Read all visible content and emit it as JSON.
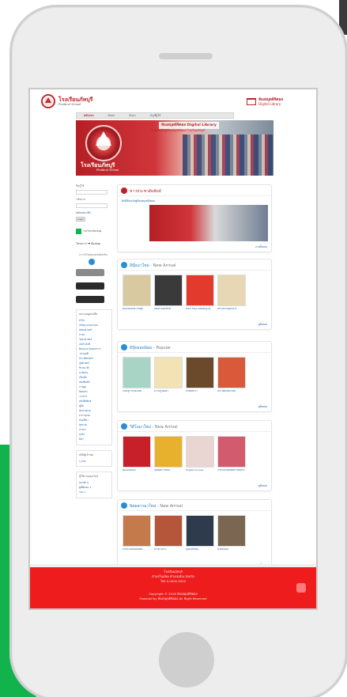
{
  "header": {
    "school_name_th": "โรงเรียนภัทบุรี",
    "school_name_en": "Phatburi School",
    "library_title": "ห้องสมุดดิจิตอล",
    "library_sub": "Digital Library"
  },
  "nav": {
    "items": [
      "หน้าแรก",
      "ติดต่อ",
      "ค้นหา",
      "บัญชีผู้ใช้"
    ]
  },
  "banner": {
    "library_name": "ห้องสมุดดิจิตอล Digital Library",
    "tagline": "ยินดีต้อนรับสู่ห้องสมุดดิจิตอล โรงเรียนภัทบุรี",
    "title_th": "โรงเรียนภัทบุรี",
    "title_en": "Phatburi School"
  },
  "sidebar": {
    "login_label": "ชื่อผู้ใช้",
    "password_label": "รหัสผ่าน",
    "register_link": "สมัครสมาชิก",
    "login_button": "Login",
    "promo1": "ร่วมรักษาห้องสมุด",
    "promo2": "โครงการ I ❤ ห้องสมุด",
    "app_text": "ดาวน์โหลดแอปพลิเคชัน",
    "categories_title": "หมวดหมู่หนังสือ",
    "categories": [
      "ทั่วไป",
      "ปรัชญาและศาสนา",
      "สังคมศาสตร์",
      "ภาษา",
      "วิทยาศาสตร์",
      "เทคโนโลยี",
      "ศิลปะและนันทนาการ",
      "วรรณคดี",
      "ประวัติศาสตร์",
      "ภูมิศาสตร์",
      "ชีวประวัติ",
      "นวนิยาย",
      "เรื่องสั้น",
      "หนังสือเด็ก",
      "การ์ตูน",
      "นิตยสาร",
      "วารสาร",
      "หนังสือพิมพ์",
      "คู่มือ",
      "พจนานุกรม",
      "สารานุกรม",
      "ท่องเที่ยว",
      "สุขภาพ",
      "อาหาร",
      "ธุรกิจ",
      "อื่นๆ"
    ],
    "stats_title": "สถิติผู้เข้าชม",
    "stats_value": "1,234",
    "online_title": "ผู้ใช้งานออนไลน์",
    "online_lines": [
      "สมาชิก 0",
      "ผู้เยี่ยมชม 1",
      "รวม 1"
    ]
  },
  "main": {
    "news": {
      "title": "ข่าวประชาสัมพันธ์",
      "link": "ยินดีต้อนรับสู่ห้องสมุดดิจิตอล",
      "more": "อ่านทั้งหมด"
    },
    "sections": [
      {
        "title_th": "อีบุ๊คมาใหม่",
        "title_en": "New Arrival",
        "color": "#2a8dd4",
        "books": [
          "ดอกไม้แห่งความสุข",
          "เส้นทางแห่งชีวิต",
          "Mind Map ฉบับสมบูรณ์",
          "สร้างแรงบันดาลใจ"
        ]
      },
      {
        "title_th": "อีบุ๊คยอดนิยม",
        "title_en": "Popular",
        "color": "#2a8dd4",
        "books": [
          "เรียนรู้ภาษาอังกฤษ",
          "ความรู้รอบตัว",
          "ชีวิตที่ดีกว่า",
          "ประวัติศาสตร์ไทย"
        ]
      },
      {
        "title_th": "วีดีโอมาใหม่",
        "title_en": "New Arrival",
        "color": "#2a8dd4",
        "books": [
          "พัฒนาตนเอง",
          "เทคนิคการสอน",
          "English Course",
          "ภาษาอังกฤษเพื่อการสื่อสาร"
        ]
      },
      {
        "title_th": "นิตยสารมาใหม่",
        "title_en": "New Arrival",
        "color": "#2a8dd4",
        "books": [
          "อาหารไทยยอดนิยม",
          "ครัวบ้านเรา",
          "บุคคลสำคัญ",
          "ชีวิตชนบท"
        ]
      }
    ],
    "more_label": "ดูทั้งหมด"
  },
  "footer": {
    "line1": "โรงเรียนภัทบุรี",
    "line2": "ตำบลในเมือง อำเภอเมือง จังหวัด",
    "line3": "โทร 0-0000-0000",
    "line4": "Copyright © 2016 ห้องสมุดดิจิตอล",
    "line5": "Powered by ห้องสมุดดิจิตอล All Right Reserved"
  },
  "colors": {
    "brand_red": "#b8252a",
    "footer_red": "#ee1c1c",
    "link_blue": "#1a5fa6",
    "accent_green": "#12b24d"
  }
}
